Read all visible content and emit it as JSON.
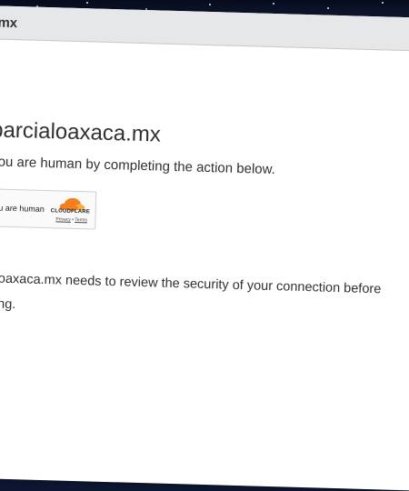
{
  "tab": {
    "title": "mx"
  },
  "page": {
    "title": "parcialoaxaca.mx",
    "subtitle": "you are human by completing the action below."
  },
  "widget": {
    "label": "you are human",
    "brand": "CLOUDFLARE",
    "privacy": "Privacy",
    "separator": "•",
    "terms": "Terms"
  },
  "message": {
    "line1": "aloaxaca.mx needs to review the security of your connection before",
    "line2": "ding."
  },
  "colors": {
    "cloudflare_orange": "#f38020",
    "cloudflare_light": "#faae40",
    "text": "#313131"
  }
}
